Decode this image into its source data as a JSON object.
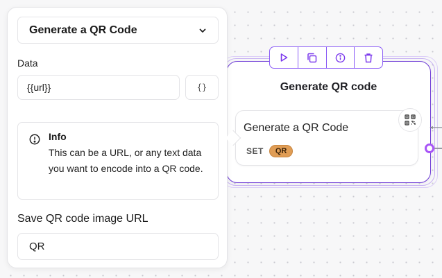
{
  "panel": {
    "block_type_select": "Generate a QR Code",
    "data_label": "Data",
    "data_value": "{{url}}",
    "variable_button_label": "{}",
    "info": {
      "title": "Info",
      "text": "This can be a URL, or any text data you want to encode into a QR code."
    },
    "save_label": "Save QR code image URL",
    "save_value": "QR"
  },
  "node": {
    "title": "Generate QR code",
    "block": {
      "title": "Generate a QR Code",
      "set_label": "SET",
      "variable": "QR"
    },
    "toolbar": [
      "play-icon",
      "duplicate-icon",
      "info-icon",
      "trash-icon"
    ]
  },
  "colors": {
    "accent": "#8b5cf6",
    "node_border": "#6e3cd6",
    "variable_badge": "#e09d55",
    "endpoint": "#a855f7"
  }
}
